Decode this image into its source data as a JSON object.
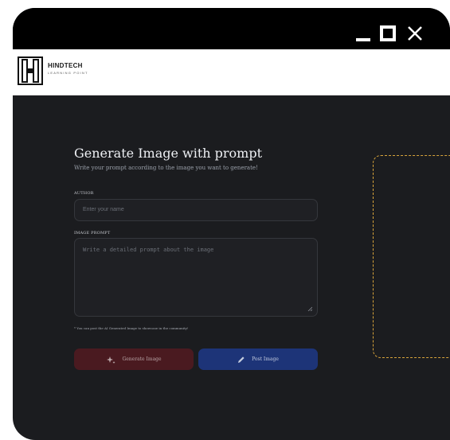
{
  "window": {
    "controls": [
      "minimize-icon",
      "maximize-icon",
      "close-icon"
    ]
  },
  "brand": {
    "name": "HINDTECH",
    "tagline": "LEARNING POINT",
    "logo": "hindtech-logo"
  },
  "form": {
    "title": "Generate Image with prompt",
    "subtitle": "Write your prompt according to the image you want to generate!",
    "author_label": "AUTHOR",
    "author_placeholder": "Enter your name",
    "prompt_label": "IMAGE PROMPT",
    "prompt_placeholder": "Write a detailed prompt about the image",
    "note": "* You can post the AI Generated Image to showcase in the community!",
    "generate_button": "Generate Image",
    "generate_icon": "sparkle-icon",
    "post_button": "Post Image",
    "post_icon": "pencil-icon"
  },
  "colors": {
    "background": "#1b1c1f",
    "generate_button": "#4a1a20",
    "post_button": "#1d3478",
    "preview_border": "#d7a33a"
  }
}
